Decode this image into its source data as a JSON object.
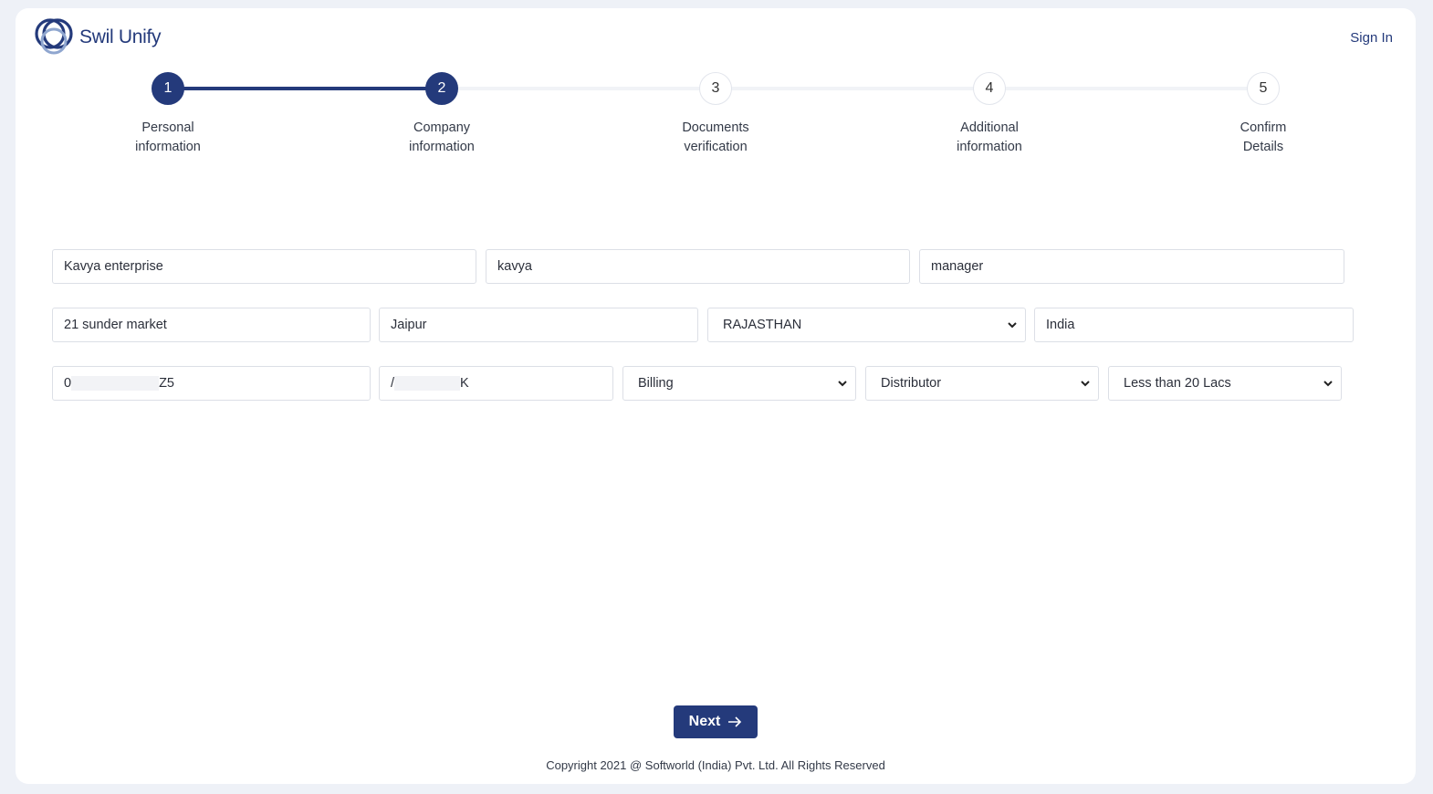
{
  "brand": {
    "name": "Swil Unify"
  },
  "header": {
    "signin_label": "Sign In"
  },
  "stepper": {
    "steps": [
      {
        "number": "1",
        "line1": "Personal",
        "line2": "information"
      },
      {
        "number": "2",
        "line1": "Company",
        "line2": "information"
      },
      {
        "number": "3",
        "line1": "Documents",
        "line2": "verification"
      },
      {
        "number": "4",
        "line1": "Additional",
        "line2": "information"
      },
      {
        "number": "5",
        "line1": "Confirm",
        "line2": "Details"
      }
    ],
    "current_step": 2
  },
  "form": {
    "company_name": "Kavya enterprise",
    "contact_name": "kavya",
    "designation": "manager",
    "address": "21 sunder market",
    "city": "Jaipur",
    "state": "RAJASTHAN",
    "country": "India",
    "gst_prefix": "0",
    "gst_suffix": "Z5",
    "pan_prefix": "/",
    "pan_suffix": "K",
    "business_type": "Billing",
    "business_category": "Distributor",
    "turnover": "Less than 20 Lacs"
  },
  "actions": {
    "next_label": "Next"
  },
  "footer": {
    "copyright": "Copyright 2021 @ Softworld (India) Pvt. Ltd. All Rights Reserved"
  },
  "colors": {
    "primary": "#243a7b",
    "background": "#eef1f7",
    "border": "#dcdfe6"
  }
}
